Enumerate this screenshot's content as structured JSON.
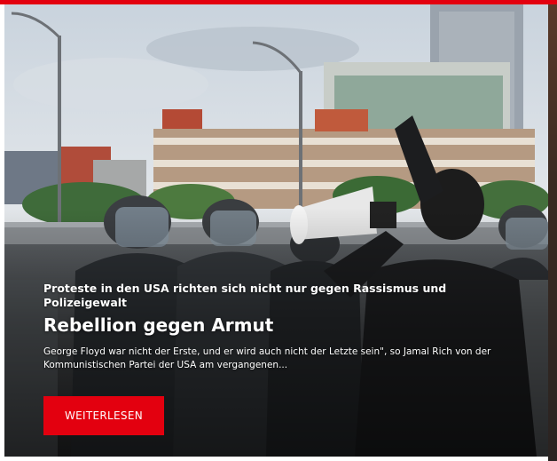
{
  "colors": {
    "accent": "#e3000f",
    "button_text": "#ffffff"
  },
  "article": {
    "kicker": "Proteste in den USA richten sich nicht nur gegen Rassismus und Polizeigewalt",
    "headline": "Rebellion gegen Armut",
    "teaser": "George Floyd war nicht der Erste, und er wird auch nicht der Letzte sein\", so Jamal Rich von der Kommunistischen Partei der USA am vergangenen...",
    "cta_label": "WEITERLESEN",
    "image_icon": "protest-photo-image"
  }
}
